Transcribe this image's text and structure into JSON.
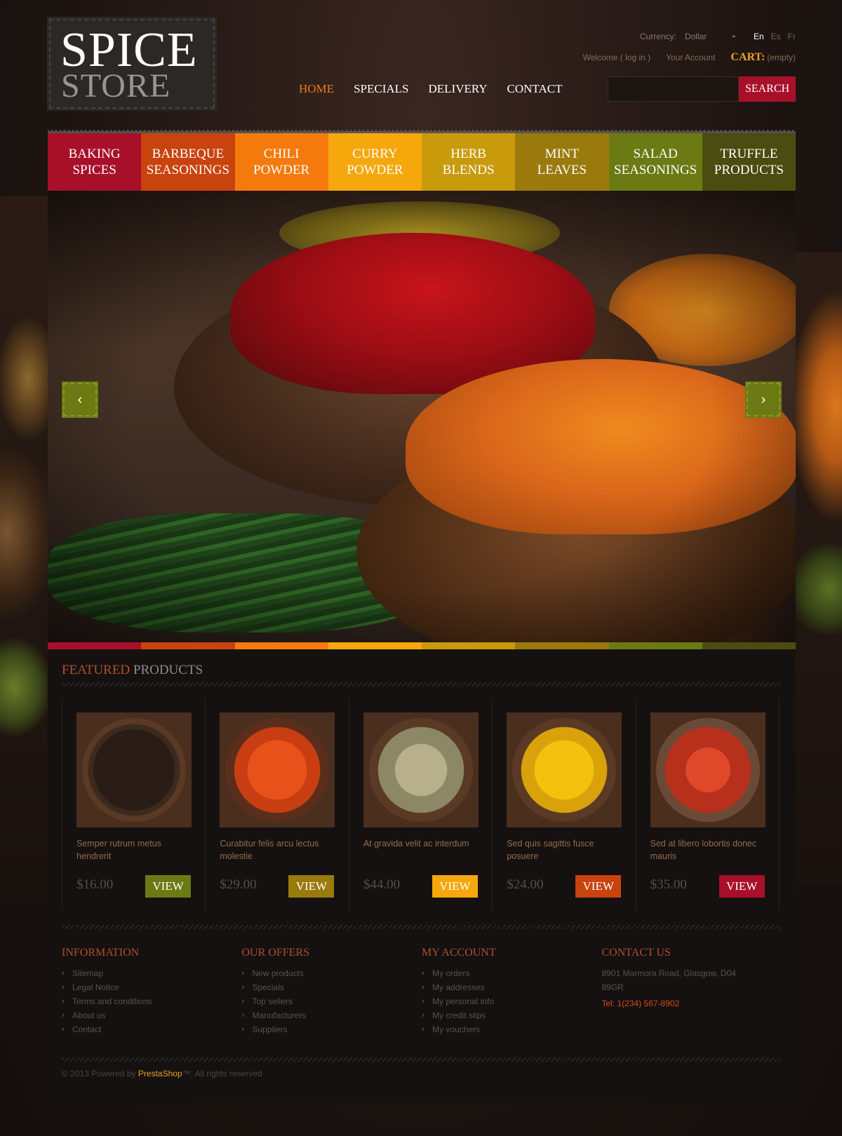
{
  "logo": {
    "line1": "SPICE",
    "line2": "STORE"
  },
  "topbar": {
    "currency_label": "Currency:",
    "currency_value": "Dollar",
    "languages": [
      "En",
      "Es",
      "Fr"
    ],
    "active_language": "En"
  },
  "userbar": {
    "welcome": "Welcome ( log in )",
    "account": "Your Account",
    "cart_label": "CART:",
    "cart_state": "(empty)"
  },
  "nav": {
    "items": [
      "HOME",
      "SPECIALS",
      "DELIVERY",
      "CONTACT"
    ],
    "active": "HOME"
  },
  "search": {
    "button": "SEARCH",
    "value": ""
  },
  "categories": [
    {
      "label": "BAKING\nSPICES",
      "color": "#a8102a"
    },
    {
      "label": "BARBEQUE\nSEASONINGS",
      "color": "#c9430e"
    },
    {
      "label": "CHILI\nPOWDER",
      "color": "#f47a0e"
    },
    {
      "label": "CURRY\nPOWDER",
      "color": "#f6a70b"
    },
    {
      "label": "HERB\nBLENDS",
      "color": "#c99a0c"
    },
    {
      "label": "MINT\nLEAVES",
      "color": "#9a7a0c"
    },
    {
      "label": "SALAD\nSEASONINGS",
      "color": "#6b7a12"
    },
    {
      "label": "TRUFFLE\nPRODUCTS",
      "color": "#4a4c10"
    }
  ],
  "slider": {
    "prev": "‹",
    "next": "›"
  },
  "featured": {
    "title_part1": "FEATURED",
    "title_part2": "PRODUCTS",
    "products": [
      {
        "name": "Semper rutrum metus hendrerit",
        "price": "$16.00",
        "button": "VIEW",
        "button_color": "#6b7a12",
        "image": "black-pepper"
      },
      {
        "name": "Curabitur felis arcu lectus molestie",
        "price": "$29.00",
        "button": "VIEW",
        "button_color": "#9a7a0c",
        "image": "paprika"
      },
      {
        "name": "At gravida velit ac interdum",
        "price": "$44.00",
        "button": "VIEW",
        "button_color": "#f6a70b",
        "image": "dried-herbs"
      },
      {
        "name": "Sed quis sagittis fusce posuere",
        "price": "$24.00",
        "button": "VIEW",
        "button_color": "#c9430e",
        "image": "turmeric"
      },
      {
        "name": "Sed at libero lobortis donec mauris",
        "price": "$35.00",
        "button": "VIEW",
        "button_color": "#a8102a",
        "image": "saffron"
      }
    ]
  },
  "footer": {
    "information": {
      "title": "INFORMATION",
      "items": [
        "Sitemap",
        "Legal Notice",
        "Terms and conditions",
        "About us",
        "Contact"
      ]
    },
    "offers": {
      "title": "OUR OFFERS",
      "items": [
        "New products",
        "Specials",
        "Top sellers",
        "Manufacturers",
        "Suppliers"
      ]
    },
    "account": {
      "title": "MY ACCOUNT",
      "items": [
        "My orders",
        "My addresses",
        "My personal info",
        "My credit slips",
        "My vouchers"
      ]
    },
    "contact": {
      "title": "CONTACT US",
      "address": "8901 Marmora Road, Glasgow, D04 89GR",
      "tel": "Tel: 1(234) 567-8902"
    }
  },
  "copyright": {
    "prefix": "© 2013 Powered by ",
    "brand": "PrestaShop",
    "suffix": "™. All rights reserved"
  }
}
